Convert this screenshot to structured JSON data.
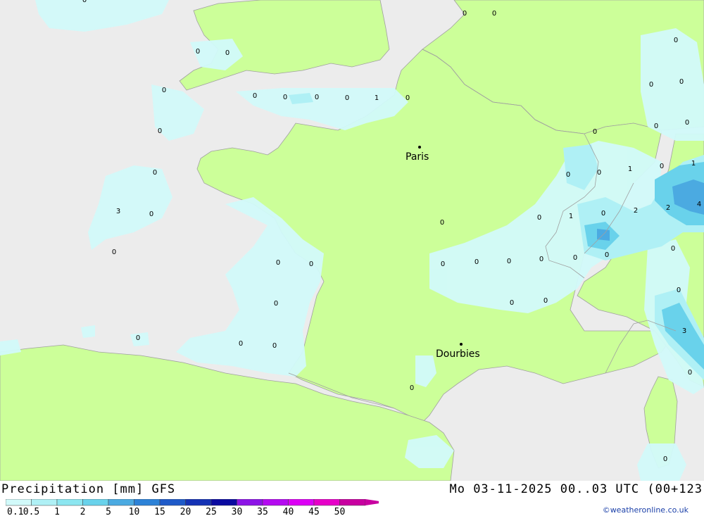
{
  "header": {
    "title": "Precipitation [mm] GFS",
    "datetime": "Mo 03-11-2025 00..03 UTC (00+123",
    "credit": "©weatheronline.co.uk"
  },
  "legend": {
    "labels": [
      "0.1",
      "0.5",
      "1",
      "2",
      "5",
      "10",
      "15",
      "20",
      "25",
      "30",
      "35",
      "40",
      "45",
      "50"
    ],
    "colors": [
      "#d2fafa",
      "#aff0f5",
      "#8ce6f0",
      "#69d2eb",
      "#4baae1",
      "#2d82d7",
      "#1e5ac8",
      "#1432b4",
      "#0a0aa0",
      "#8c14e6",
      "#b40af0",
      "#dc00f5",
      "#e600c8",
      "#c800a0"
    ]
  },
  "map_colors": {
    "sea": "#ececec",
    "land": "#ccff99",
    "precip_light": "#d2fafa",
    "precip_mid": "#aff0f5",
    "precip_high": "#69d2eb",
    "precip_max": "#4baae1",
    "border": "#a0a0a0"
  },
  "cities": [
    {
      "name": "Paris"
    },
    {
      "name": "Dourbies"
    }
  ],
  "values": [
    "0",
    "0",
    "0",
    "0",
    "0",
    "0",
    "0",
    "0",
    "0",
    "0",
    "1",
    "0",
    "0",
    "0",
    "0",
    "0",
    "0",
    "0",
    "0",
    "0",
    "0",
    "0",
    "1",
    "0",
    "1",
    "2",
    "0",
    "0",
    "1",
    "2",
    "4",
    "3",
    "0",
    "0",
    "0",
    "0",
    "0",
    "0",
    "0",
    "0",
    "0",
    "0",
    "0",
    "0",
    "0",
    "0",
    "0",
    "0",
    "0",
    "0",
    "3",
    "0",
    "0",
    "0",
    "0"
  ]
}
